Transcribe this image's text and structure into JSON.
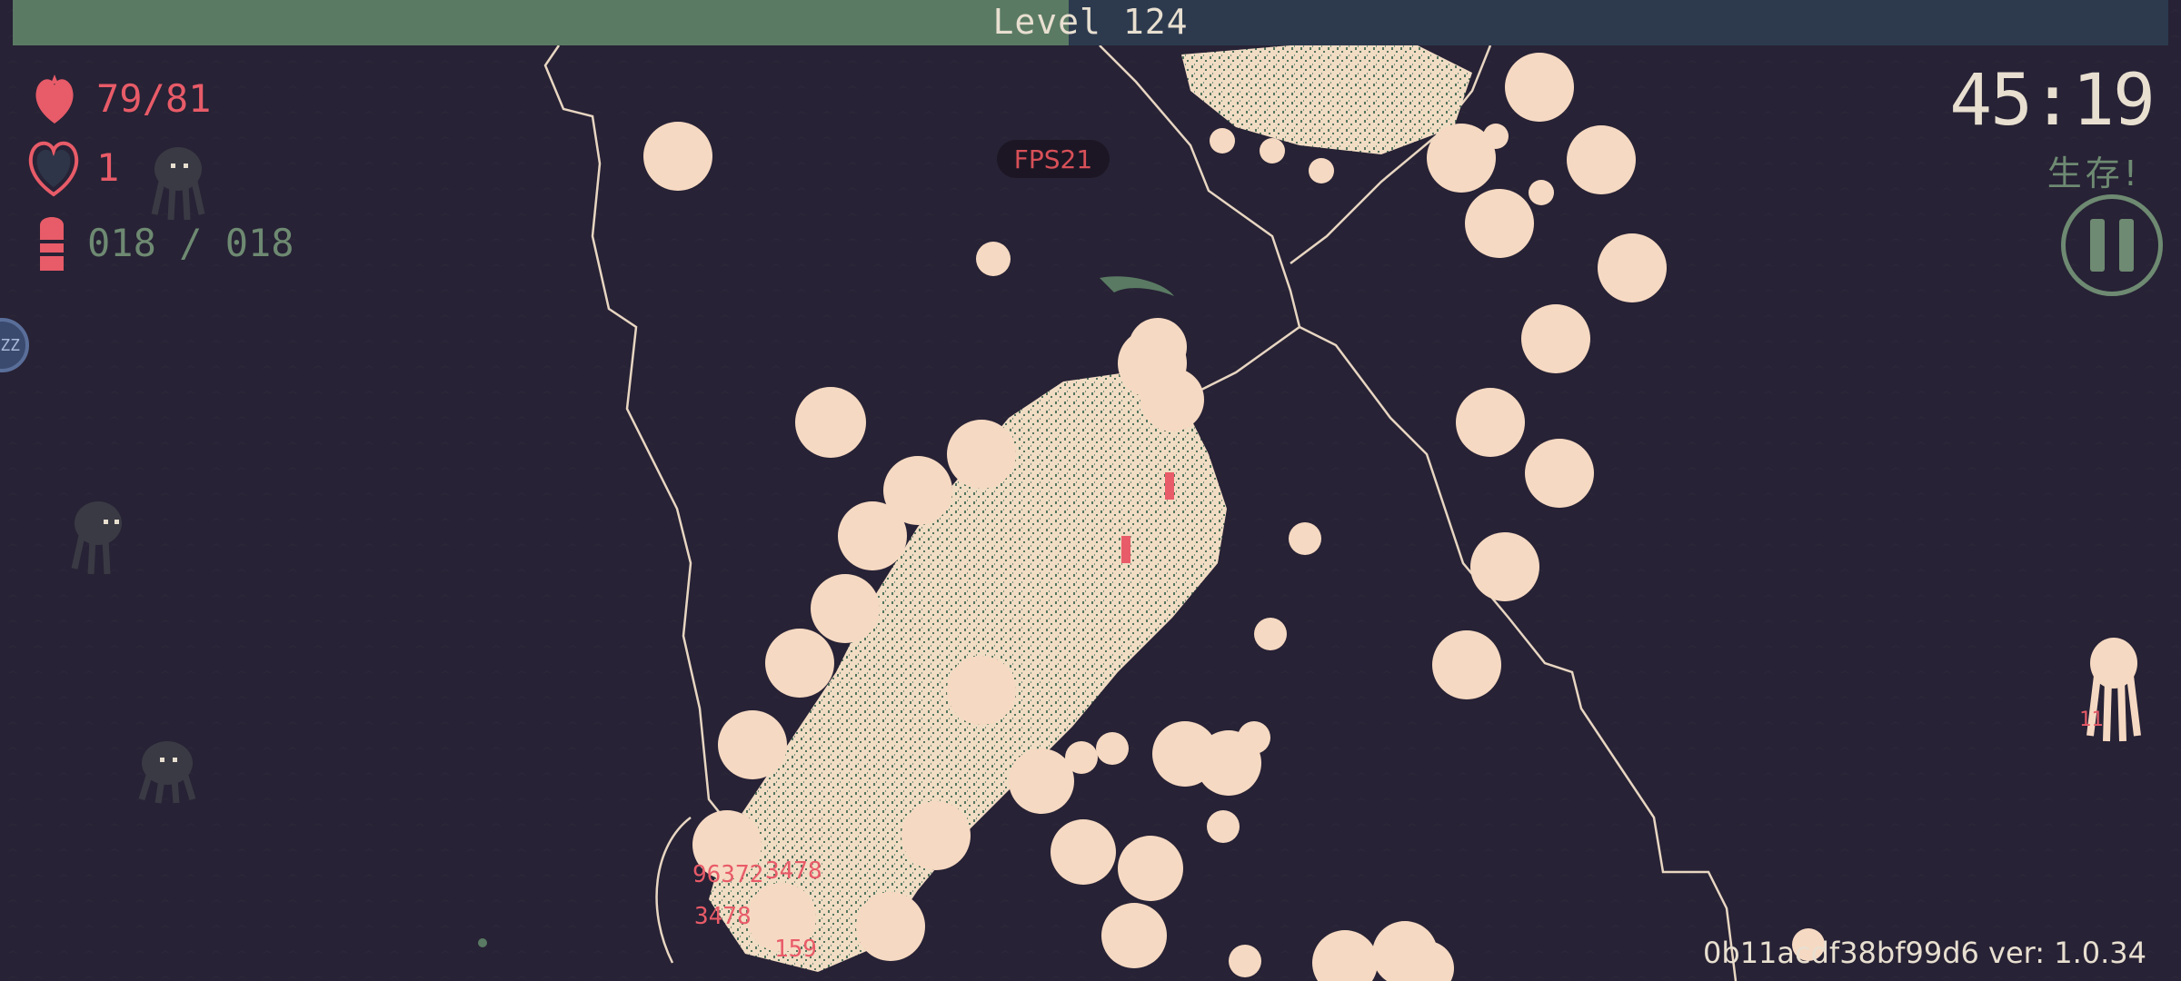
{
  "hud": {
    "level_label": "Level  124",
    "xp_progress": 0.49,
    "hp_text": "79/81",
    "armor_text": "1",
    "ammo_text": "018 / 018",
    "fps_text": "FPS21",
    "timer": "45:19",
    "status": "生存!",
    "side_button_label": "ZZ",
    "version_text": "0b11acdf38bf99d6 ver: 1.0.34"
  },
  "damage_numbers": [
    "96372",
    "3478",
    "3478",
    "159",
    "11"
  ],
  "colors": {
    "background": "#272235",
    "cream": "#f6d9c2",
    "green": "#5a7a63",
    "red": "#e85b68"
  },
  "icons": [
    "heart-icon",
    "armor-heart-icon",
    "ammo-icon",
    "pause-icon",
    "scythe-icon"
  ]
}
